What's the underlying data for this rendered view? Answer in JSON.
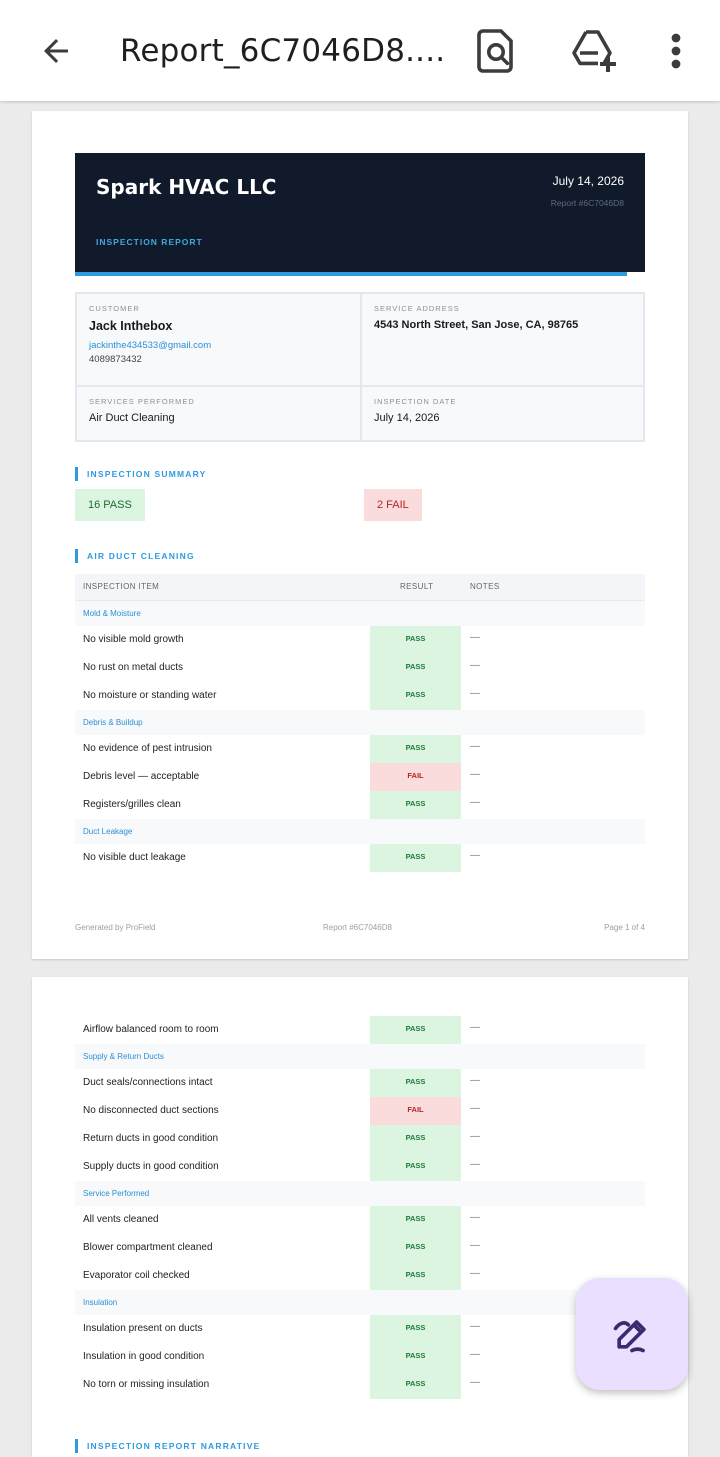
{
  "appbar": {
    "title": "Report_6C7046D8....",
    "back_icon": "arrow-back-icon",
    "find_icon": "find-in-page-icon",
    "drive_icon": "add-to-drive-icon",
    "more_icon": "more-vert-icon"
  },
  "report": {
    "company": "Spark HVAC LLC",
    "date": "July 14, 2026",
    "report_id": "Report #6C7046D8",
    "label": "INSPECTION REPORT",
    "customer_label": "CUSTOMER",
    "customer_name": "Jack Inthebox",
    "customer_email": "jackinthe434533@gmail.com",
    "customer_phone": "4089873432",
    "address_label": "SERVICE ADDRESS",
    "address": "4543 North Street, San Jose, CA, 98765",
    "services_label": "SERVICES PERFORMED",
    "services": "Air Duct Cleaning",
    "inspection_date_label": "INSPECTION DATE",
    "inspection_date": "July 14, 2026",
    "summary_title": "INSPECTION SUMMARY",
    "pass_count": "16 PASS",
    "fail_count": "2 FAIL",
    "section_title": "AIR DUCT CLEANING",
    "col_item": "INSPECTION ITEM",
    "col_result": "RESULT",
    "col_notes": "NOTES",
    "footer_left": "Generated by ProField",
    "footer_mid": "Report #6C7046D8",
    "footer_right": "Page 1 of 4",
    "narrative_title": "INSPECTION REPORT NARRATIVE"
  },
  "page1_rows": [
    {
      "type": "group",
      "label": "Mold & Moisture"
    },
    {
      "type": "item",
      "label": "No visible mold growth",
      "result": "PASS",
      "note": "—"
    },
    {
      "type": "item",
      "label": "No rust on metal ducts",
      "result": "PASS",
      "note": "—"
    },
    {
      "type": "item",
      "label": "No moisture or standing water",
      "result": "PASS",
      "note": "—"
    },
    {
      "type": "group",
      "label": "Debris & Buildup"
    },
    {
      "type": "item",
      "label": "No evidence of pest intrusion",
      "result": "PASS",
      "note": "—"
    },
    {
      "type": "item",
      "label": "Debris level — acceptable",
      "result": "FAIL",
      "note": "—"
    },
    {
      "type": "item",
      "label": "Registers/grilles clean",
      "result": "PASS",
      "note": "—"
    },
    {
      "type": "group",
      "label": "Duct Leakage"
    },
    {
      "type": "item",
      "label": "No visible duct leakage",
      "result": "PASS",
      "note": "—"
    }
  ],
  "page2_rows": [
    {
      "type": "item",
      "label": "Airflow balanced room to room",
      "result": "PASS",
      "note": "—"
    },
    {
      "type": "group",
      "label": "Supply & Return Ducts"
    },
    {
      "type": "item",
      "label": "Duct seals/connections intact",
      "result": "PASS",
      "note": "—"
    },
    {
      "type": "item",
      "label": "No disconnected duct sections",
      "result": "FAIL",
      "note": "—"
    },
    {
      "type": "item",
      "label": "Return ducts in good condition",
      "result": "PASS",
      "note": "—"
    },
    {
      "type": "item",
      "label": "Supply ducts in good condition",
      "result": "PASS",
      "note": "—"
    },
    {
      "type": "group",
      "label": "Service Performed"
    },
    {
      "type": "item",
      "label": "All vents cleaned",
      "result": "PASS",
      "note": "—"
    },
    {
      "type": "item",
      "label": "Blower compartment cleaned",
      "result": "PASS",
      "note": "—"
    },
    {
      "type": "item",
      "label": "Evaporator coil checked",
      "result": "PASS",
      "note": "—"
    },
    {
      "type": "group",
      "label": "Insulation"
    },
    {
      "type": "item",
      "label": "Insulation present on ducts",
      "result": "PASS",
      "note": "—"
    },
    {
      "type": "item",
      "label": "Insulation in good condition",
      "result": "PASS",
      "note": "—"
    },
    {
      "type": "item",
      "label": "No torn or missing insulation",
      "result": "PASS",
      "note": "—"
    }
  ],
  "fab": {
    "icon": "draw-annotate-icon"
  }
}
